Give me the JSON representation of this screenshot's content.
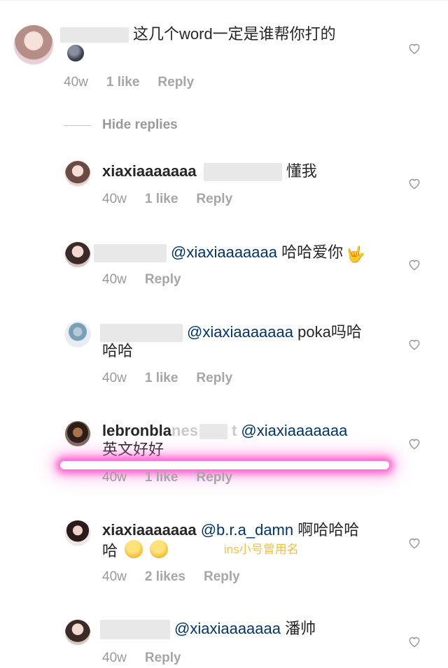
{
  "main_comment": {
    "text": "这几个word一定是谁帮你打的",
    "emoji": "new-moon-face",
    "time": "40w",
    "likes": "1 like",
    "reply": "Reply"
  },
  "hide_replies": "Hide replies",
  "replies": [
    {
      "user": "xiaxiaaaaaaa",
      "text": "懂我",
      "time": "40w",
      "likes": "1 like",
      "reply": "Reply"
    },
    {
      "mention": "@xiaxiaaaaaaa",
      "text": "哈哈爱你",
      "emoji": "sign-of-horns",
      "time": "40w",
      "reply": "Reply"
    },
    {
      "mention": "@xiaxiaaaaaaa",
      "text": "poka吗哈",
      "text2": "哈哈",
      "time": "40w",
      "likes": "1 like",
      "reply": "Reply"
    },
    {
      "user": "lebronbla",
      "user_blur": "nes",
      "user_tail": "t",
      "mention": "@xiaxiaaaaaaa",
      "text2": "英文好好",
      "time": "40w",
      "likes": "1 like",
      "reply": "Reply"
    },
    {
      "user": "xiaxiaaaaaaa",
      "mention": "@b.r.a_damn",
      "text": "啊哈哈哈",
      "text2": "哈",
      "emoji": "zipper-mouth-face",
      "time": "40w",
      "likes": "2 likes",
      "reply": "Reply",
      "annotation": "ins小号曾用名"
    },
    {
      "mention": "@xiaxiaaaaaaa",
      "text": "潘帅",
      "time": "40w",
      "reply": "Reply"
    }
  ],
  "colors": {
    "mention": "#003569",
    "meta": "#999999",
    "highlight": "#ff50c8",
    "annotation": "#f0c040"
  }
}
